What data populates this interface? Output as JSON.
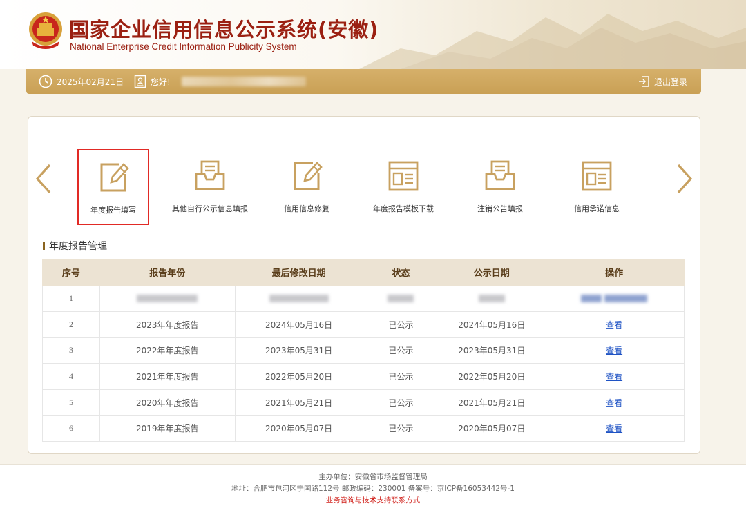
{
  "header": {
    "title_cn": "国家企业信用信息公示系统(安徽)",
    "title_en": "National Enterprise Credit Information Publicity System"
  },
  "topbar": {
    "date": "2025年02月21日",
    "greeting": "您好!",
    "logout_label": "退出登录"
  },
  "functions": [
    {
      "label": "年度报告填写",
      "icon": "edit-icon",
      "active": true
    },
    {
      "label": "其他自行公示信息填报",
      "icon": "inbox-document-icon",
      "active": false
    },
    {
      "label": "信用信息修复",
      "icon": "edit-icon",
      "active": false
    },
    {
      "label": "年度报告模板下载",
      "icon": "template-icon",
      "active": false
    },
    {
      "label": "注销公告填报",
      "icon": "inbox-document-icon",
      "active": false
    },
    {
      "label": "信用承诺信息",
      "icon": "template-icon",
      "active": false
    }
  ],
  "section": {
    "title": "年度报告管理"
  },
  "table": {
    "headers": [
      "序号",
      "报告年份",
      "最后修改日期",
      "状态",
      "公示日期",
      "操作"
    ],
    "rows": [
      {
        "index": "1",
        "year": "",
        "modified": "",
        "status": "",
        "published": "",
        "action": ""
      },
      {
        "index": "2",
        "year": "2023年年度报告",
        "modified": "2024年05月16日",
        "status": "已公示",
        "published": "2024年05月16日",
        "action": "查看"
      },
      {
        "index": "3",
        "year": "2022年年度报告",
        "modified": "2023年05月31日",
        "status": "已公示",
        "published": "2023年05月31日",
        "action": "查看"
      },
      {
        "index": "4",
        "year": "2021年年度报告",
        "modified": "2022年05月20日",
        "status": "已公示",
        "published": "2022年05月20日",
        "action": "查看"
      },
      {
        "index": "5",
        "year": "2020年年度报告",
        "modified": "2021年05月21日",
        "status": "已公示",
        "published": "2021年05月21日",
        "action": "查看"
      },
      {
        "index": "6",
        "year": "2019年年度报告",
        "modified": "2020年05月07日",
        "status": "已公示",
        "published": "2020年05月07日",
        "action": "查看"
      }
    ]
  },
  "footer": {
    "sponsor": "主办单位：安徽省市场监督管理局",
    "address": "地址：合肥市包河区宁国路112号 邮政编码：230001 备案号：京ICP备16053442号-1",
    "contact": "业务咨询与技术支持联系方式"
  },
  "colors": {
    "brand_red": "#9b2012",
    "gold_bar": "#c9a055",
    "icon_gold": "#c8a160",
    "table_header": "#ece3d3",
    "highlight_red": "#e12a25",
    "link_blue": "#1f53c4"
  }
}
